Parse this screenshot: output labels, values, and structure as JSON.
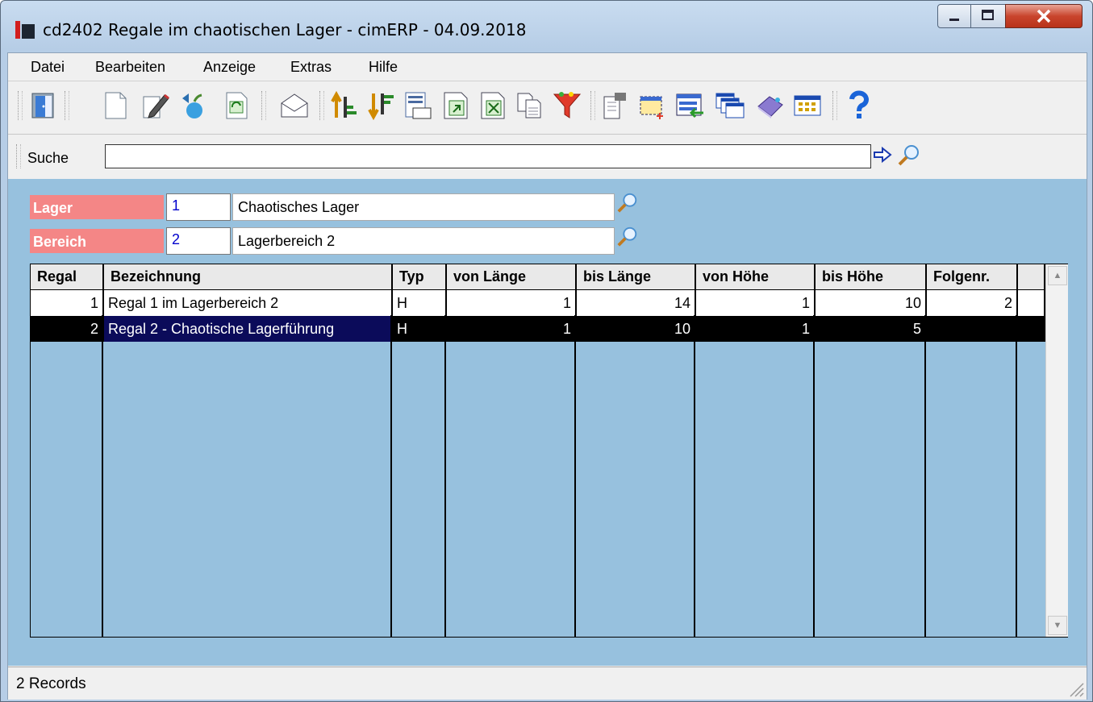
{
  "window": {
    "title": "cd2402 Regale im chaotischen Lager - cimERP - 04.09.2018",
    "controls": [
      "minimize",
      "maximize",
      "close"
    ]
  },
  "menu": [
    "Datei",
    "Bearbeiten",
    "Anzeige",
    "Extras",
    "Hilfe"
  ],
  "toolbar": {
    "icons": [
      "exit-door-icon",
      "new-document-icon",
      "edit-pencil-icon",
      "save-apple-icon",
      "refresh-icon",
      "mail-icon",
      "sort-ascending-icon",
      "sort-descending-icon",
      "calculator-icon",
      "export-icon",
      "excel-icon",
      "copy-icon",
      "filter-funnel-icon",
      "properties-icon",
      "select-range-icon",
      "import-icon",
      "windows-icon",
      "book-icon",
      "grid-view-icon",
      "help-icon"
    ]
  },
  "search": {
    "label": "Suche",
    "value": ""
  },
  "form": {
    "lager": {
      "label": "Lager",
      "code": "1",
      "name": "Chaotisches Lager"
    },
    "bereich": {
      "label": "Bereich",
      "code": "2",
      "name": "Lagerbereich 2"
    }
  },
  "grid": {
    "columns": [
      "Regal",
      "Bezeichnung",
      "Typ",
      "von Länge",
      "bis Länge",
      "von Höhe",
      "bis Höhe",
      "Folgenr."
    ],
    "rows": [
      {
        "regal": "1",
        "bezeichnung": "Regal 1 im Lagerbereich 2",
        "typ": "H",
        "von_laenge": "1",
        "bis_laenge": "14",
        "von_hoehe": "1",
        "bis_hoehe": "10",
        "folgenr": "2"
      },
      {
        "regal": "2",
        "bezeichnung": "Regal 2 - Chaotische Lagerführung",
        "typ": "H",
        "von_laenge": "1",
        "bis_laenge": "10",
        "von_hoehe": "1",
        "bis_hoehe": "5",
        "folgenr": ""
      }
    ]
  },
  "status": {
    "text": "2 Records"
  },
  "colors": {
    "label_bg": "#f48686",
    "grid_bg": "#97c1de",
    "selected_row": "#000000"
  }
}
